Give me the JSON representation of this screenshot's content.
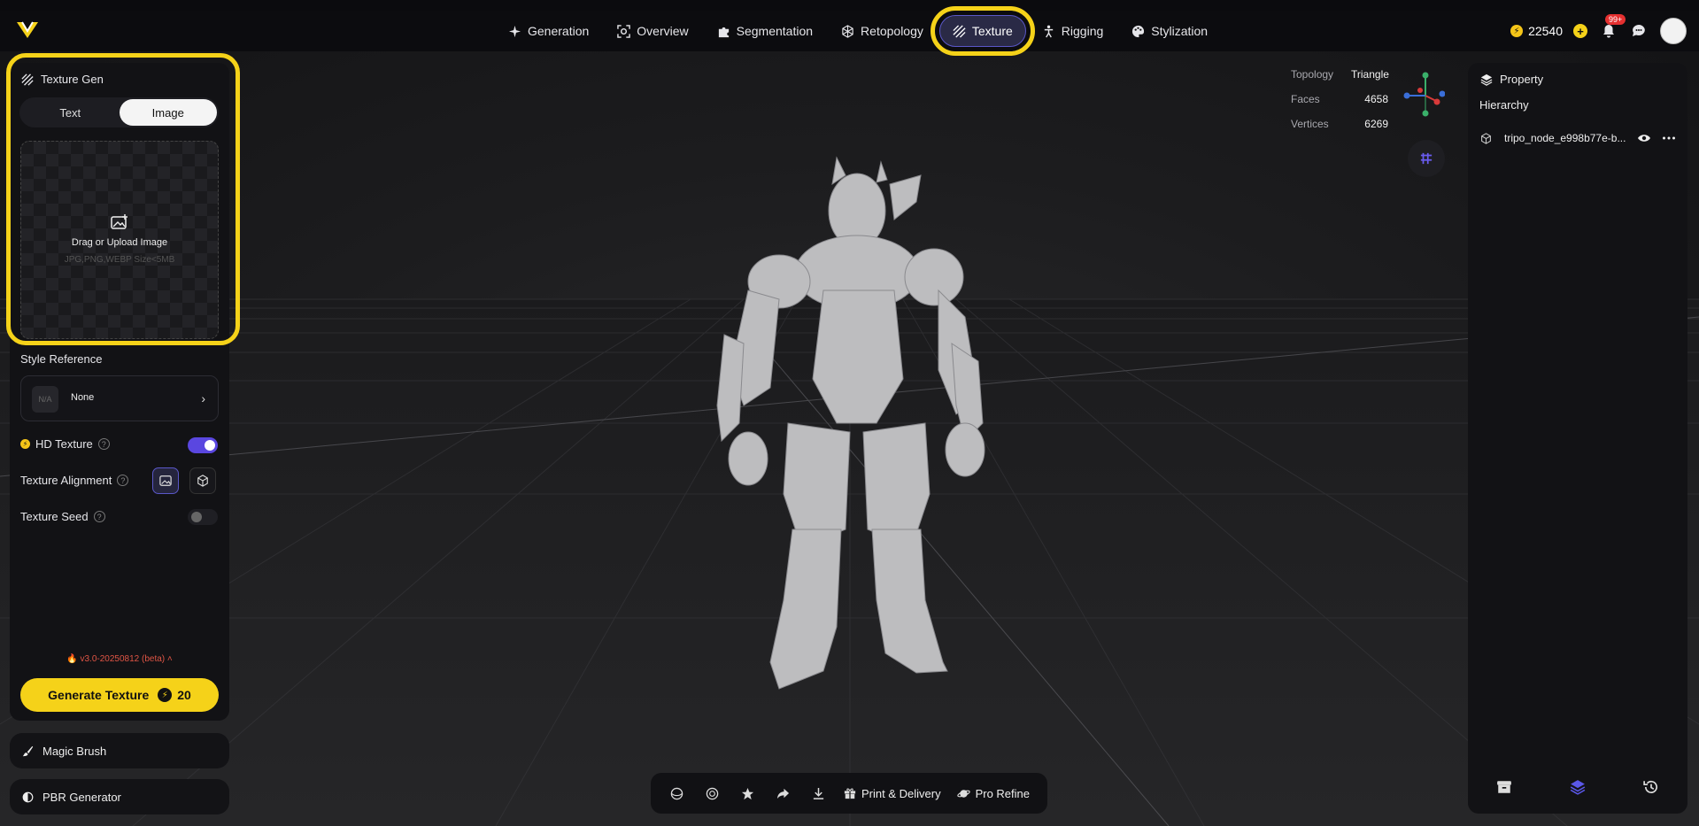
{
  "nav": {
    "items": [
      {
        "label": "Generation",
        "icon": "sparkle-icon"
      },
      {
        "label": "Overview",
        "icon": "scan-icon"
      },
      {
        "label": "Segmentation",
        "icon": "puzzle-icon"
      },
      {
        "label": "Retopology",
        "icon": "mesh-icon"
      },
      {
        "label": "Texture",
        "icon": "texture-icon",
        "active": true
      },
      {
        "label": "Rigging",
        "icon": "figure-icon"
      },
      {
        "label": "Stylization",
        "icon": "palette-icon"
      }
    ]
  },
  "header": {
    "credits": "22540",
    "notification_badge": "99+"
  },
  "left_panel": {
    "title": "Texture Gen",
    "tabs": {
      "text": "Text",
      "image": "Image",
      "selected": "Image"
    },
    "upload": {
      "label": "Drag or Upload Image",
      "hint": "JPG,PNG,WEBP Size<5MB"
    },
    "style_reference": {
      "label": "Style Reference",
      "thumb": "N/A",
      "value": "None"
    },
    "hd_texture": {
      "label": "HD Texture",
      "enabled": true
    },
    "texture_alignment": {
      "label": "Texture Alignment"
    },
    "texture_seed": {
      "label": "Texture Seed",
      "enabled": false
    },
    "version": "v3.0-20250812 (beta)",
    "generate": {
      "label": "Generate Texture",
      "cost": "20"
    }
  },
  "tools": {
    "magic_brush": "Magic Brush",
    "pbr_generator": "PBR Generator"
  },
  "stats": {
    "topology_label": "Topology",
    "topology_value": "Triangle",
    "faces_label": "Faces",
    "faces_value": "4658",
    "vertices_label": "Vertices",
    "vertices_value": "6269"
  },
  "right_panel": {
    "title": "Property",
    "hierarchy": "Hierarchy",
    "node_name": "tripo_node_e998b77e-b..."
  },
  "bottom_bar": {
    "print_delivery": "Print & Delivery",
    "pro_refine": "Pro Refine"
  },
  "colors": {
    "accent": "#f5d219",
    "primary": "#5a57c8",
    "danger": "#e53030"
  }
}
